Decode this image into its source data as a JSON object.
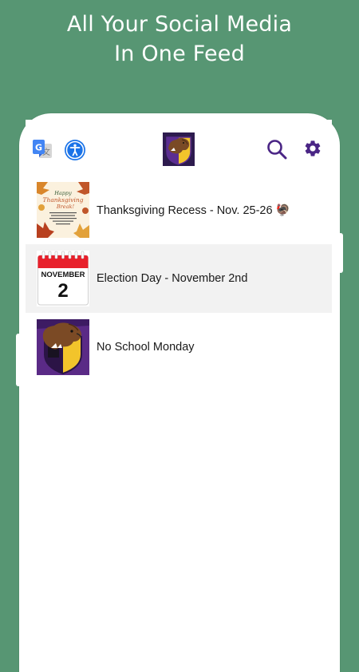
{
  "headline": {
    "line1": "All Your Social Media",
    "line2": "In One Feed"
  },
  "colors": {
    "background": "#579673",
    "accent_purple": "#4a2585",
    "gold": "#f2c42b",
    "a11y_blue": "#1a73e8"
  },
  "toolbar": {
    "icons": [
      "translate-icon",
      "accessibility-icon",
      "school-logo",
      "search-icon",
      "gear-icon"
    ]
  },
  "feed": {
    "items": [
      {
        "title": "Thanksgiving Recess - Nov. 25-26 🦃",
        "thumb": "thanksgiving-card",
        "thumb_text_1": "Happy",
        "thumb_text_2": "Thanksgiving",
        "thumb_text_3": "Break!"
      },
      {
        "title": "Election Day - November 2nd",
        "thumb": "calendar",
        "month": "NOVEMBER",
        "day": "2"
      },
      {
        "title": "No School Monday",
        "thumb": "school-logo"
      }
    ]
  }
}
